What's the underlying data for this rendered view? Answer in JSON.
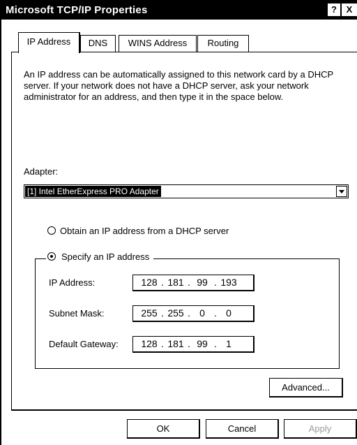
{
  "window": {
    "title": "Microsoft TCP/IP Properties",
    "help_button": "?",
    "close_button": "X"
  },
  "tabs": [
    {
      "label": "IP Address",
      "active": true
    },
    {
      "label": "DNS",
      "active": false
    },
    {
      "label": "WINS Address",
      "active": false
    },
    {
      "label": "Routing",
      "active": false
    }
  ],
  "description": "An IP address can be automatically assigned to this network card by a DHCP server.  If your network does not have a DHCP server, ask your network administrator for an address, and then type it in the space below.",
  "adapter": {
    "label": "Adapter:",
    "selected": "[1] Intel EtherExpress PRO Adapter"
  },
  "options": {
    "dhcp": {
      "label": "Obtain an IP address from a DHCP server",
      "checked": false
    },
    "specify": {
      "label": "Specify an IP address",
      "checked": true
    }
  },
  "fields": {
    "ip": {
      "label": "IP Address:",
      "octets": [
        "128",
        "181",
        "99",
        "193"
      ]
    },
    "subnet": {
      "label": "Subnet Mask:",
      "octets": [
        "255",
        "255",
        "0",
        "0"
      ]
    },
    "gateway": {
      "label": "Default Gateway:",
      "octets": [
        "128",
        "181",
        "99",
        "1"
      ]
    }
  },
  "buttons": {
    "advanced": "Advanced...",
    "ok": "OK",
    "cancel": "Cancel",
    "apply": "Apply"
  }
}
